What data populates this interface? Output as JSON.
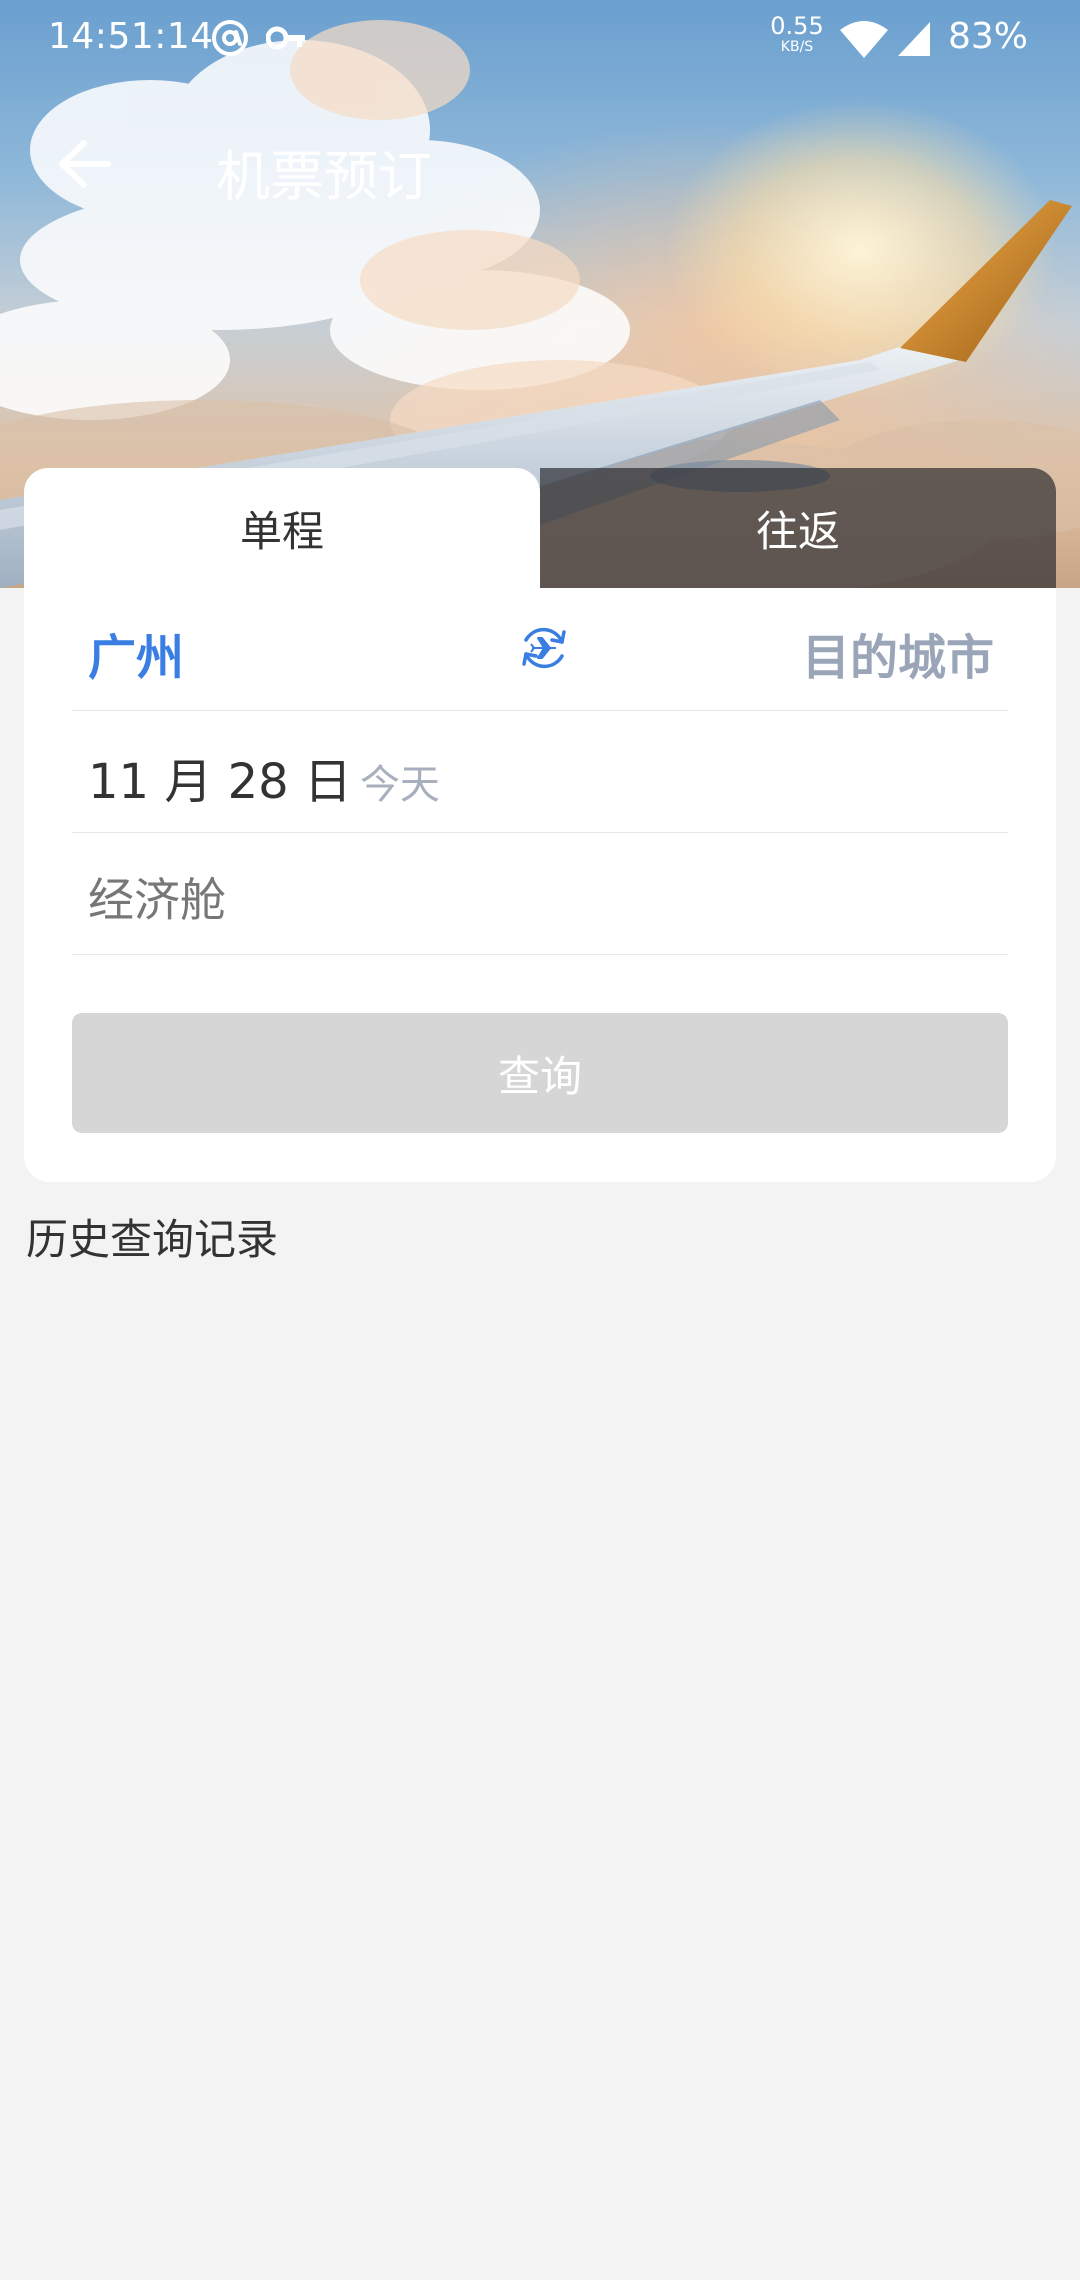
{
  "status_bar": {
    "time": "14:51:14",
    "net_speed": "0.55",
    "net_speed_unit": "KB/S",
    "battery": "83%"
  },
  "toolbar": {
    "title": "机票预订"
  },
  "tabs": [
    {
      "label": "单程",
      "active": true
    },
    {
      "label": "往返",
      "active": false
    }
  ],
  "search_form": {
    "from_city": "广州",
    "to_city": "目的城市",
    "date": "11 月 28 日",
    "date_hint": "今天",
    "cabin": "经济舱",
    "query_label": "查询"
  },
  "history": {
    "title": "历史查询记录"
  },
  "colors": {
    "accent": "#3a7ee3",
    "placeholder": "#9aa5b8",
    "button_disabled": "#d6d6d6",
    "background": "#f3f3f3"
  }
}
